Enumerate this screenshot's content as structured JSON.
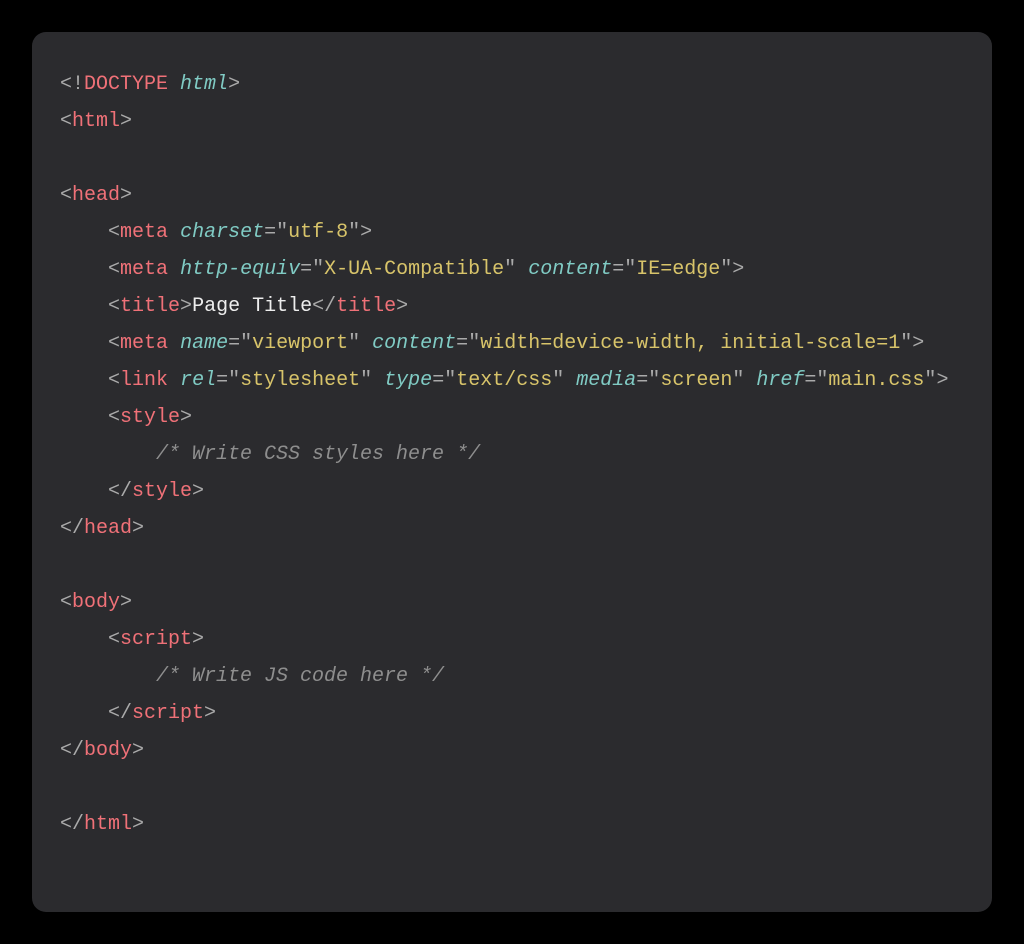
{
  "syntax": {
    "lt": "<",
    "gt": ">",
    "ltbang": "<!",
    "ltslash": "</",
    "eq": "=",
    "q": "\""
  },
  "tokens": {
    "doctype": "DOCTYPE",
    "html_attr": "html",
    "html": "html",
    "head": "head",
    "meta": "meta",
    "charset": "charset",
    "utf8": "utf-8",
    "http_equiv": "http-equiv",
    "xua": "X-UA-Compatible",
    "content": "content",
    "ieedge": "IE=edge",
    "title": "title",
    "page_title_text": "Page Title",
    "name": "name",
    "viewport": "viewport",
    "viewport_content": "width=device-width, initial-scale=1",
    "link": "link",
    "rel": "rel",
    "stylesheet": "stylesheet",
    "type": "type",
    "textcss": "text/css",
    "media": "media",
    "screen": "screen",
    "href": "href",
    "maincss": "main.css",
    "style": "style",
    "css_comment": "/* Write CSS styles here */",
    "body": "body",
    "script": "script",
    "js_comment": "/* Write JS code here */"
  },
  "indent": {
    "one": "    ",
    "two": "        "
  }
}
